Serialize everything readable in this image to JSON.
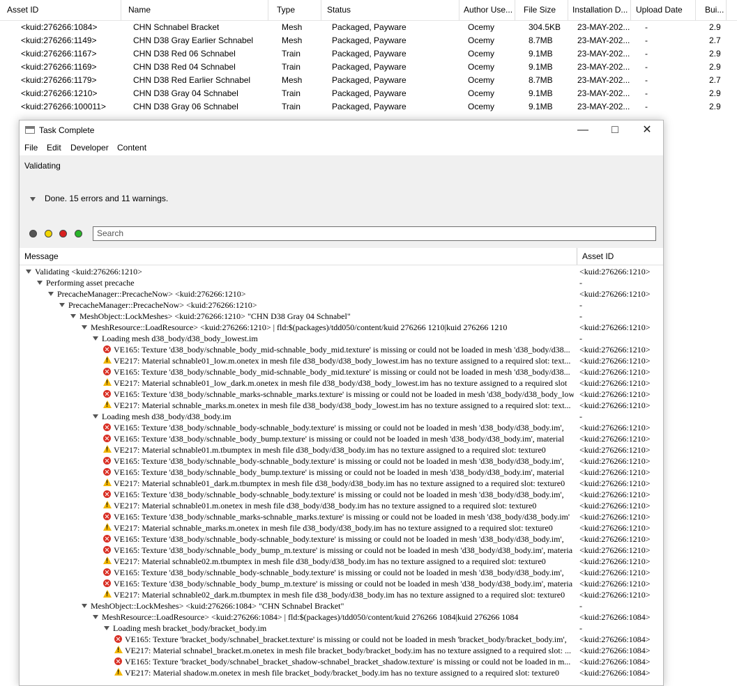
{
  "table": {
    "columns": [
      "Asset ID",
      "Name",
      "Type",
      "Status",
      "Author Use...",
      "File Size",
      "Installation D...",
      "Upload Date",
      "Bui..."
    ],
    "rows": [
      {
        "icon": "mesh-icon",
        "kuid": "<kuid:276266:1084>",
        "name": "CHN Schnabel Bracket",
        "type": "Mesh",
        "status": "Packaged, Payware",
        "author": "Ocemy",
        "size": "304.5KB",
        "installed": "23-MAY-202...",
        "upload": "-",
        "build": "2.9"
      },
      {
        "icon": "mesh-icon",
        "kuid": "<kuid:276266:1149>",
        "name": "CHN D38 Gray Earlier Schnabel",
        "type": "Mesh",
        "status": "Packaged, Payware",
        "author": "Ocemy",
        "size": "8.7MB",
        "installed": "23-MAY-202...",
        "upload": "-",
        "build": "2.7"
      },
      {
        "icon": "train-icon",
        "kuid": "<kuid:276266:1167>",
        "name": "CHN D38 Red 06 Schnabel",
        "type": "Train",
        "status": "Packaged, Payware",
        "author": "Ocemy",
        "size": "9.1MB",
        "installed": "23-MAY-202...",
        "upload": "-",
        "build": "2.9"
      },
      {
        "icon": "train-icon",
        "kuid": "<kuid:276266:1169>",
        "name": "CHN D38 Red 04 Schnabel",
        "type": "Train",
        "status": "Packaged, Payware",
        "author": "Ocemy",
        "size": "9.1MB",
        "installed": "23-MAY-202...",
        "upload": "-",
        "build": "2.9"
      },
      {
        "icon": "mesh-icon",
        "kuid": "<kuid:276266:1179>",
        "name": "CHN D38 Red Earlier Schnabel",
        "type": "Mesh",
        "status": "Packaged, Payware",
        "author": "Ocemy",
        "size": "8.7MB",
        "installed": "23-MAY-202...",
        "upload": "-",
        "build": "2.7"
      },
      {
        "icon": "train-icon",
        "kuid": "<kuid:276266:1210>",
        "name": "CHN D38 Gray 04 Schnabel",
        "type": "Train",
        "status": "Packaged, Payware",
        "author": "Ocemy",
        "size": "9.1MB",
        "installed": "23-MAY-202...",
        "upload": "-",
        "build": "2.9"
      },
      {
        "icon": "train-icon",
        "kuid": "<kuid:276266:100011>",
        "name": "CHN D38 Gray 06 Schnabel",
        "type": "Train",
        "status": "Packaged, Payware",
        "author": "Ocemy",
        "size": "9.1MB",
        "installed": "23-MAY-202...",
        "upload": "-",
        "build": "2.9"
      }
    ]
  },
  "dialog": {
    "title": "Task Complete",
    "menu": [
      "File",
      "Edit",
      "Developer",
      "Content"
    ],
    "phase": "Validating",
    "summary": "Done. 15 errors and 11 warnings.",
    "search_placeholder": "Search",
    "filter_colors": [
      "#555555",
      "#f2d600",
      "#d92020",
      "#28b428"
    ],
    "columns": {
      "message": "Message",
      "asset_id": "Asset ID"
    },
    "log": [
      {
        "level": 0,
        "kind": "expand",
        "text": "Validating <kuid:276266:1210>",
        "asset": "<kuid:276266:1210>"
      },
      {
        "level": 1,
        "kind": "expand",
        "text": "Performing asset precache",
        "asset": "-"
      },
      {
        "level": 2,
        "kind": "expand",
        "text": "PrecacheManager::PrecacheNow> <kuid:276266:1210>",
        "asset": "<kuid:276266:1210>"
      },
      {
        "level": 3,
        "kind": "expand",
        "text": "PrecacheManager::PrecacheNow> <kuid:276266:1210>",
        "asset": "-"
      },
      {
        "level": 4,
        "kind": "expand",
        "text": "MeshObject::LockMeshes> <kuid:276266:1210> \"CHN D38 Gray 04 Schnabel\"",
        "asset": "-"
      },
      {
        "level": 5,
        "kind": "expand",
        "text": "MeshResource::LoadResource> <kuid:276266:1210> | fld:$(packages)/tdd050/content/kuid 276266 1210|kuid 276266 1210",
        "asset": "<kuid:276266:1210>"
      },
      {
        "level": 6,
        "kind": "expand",
        "text": "Loading mesh d38_body/d38_body_lowest.im",
        "asset": "-"
      },
      {
        "level": 7,
        "kind": "error",
        "text": "VE165: Texture 'd38_body/schnable_body_mid-schnable_body_mid.texture' is missing or could not be loaded in mesh 'd38_body/d38...",
        "asset": "<kuid:276266:1210>"
      },
      {
        "level": 7,
        "kind": "warning",
        "text": "VE217: Material schnable01_low.m.onetex in mesh file d38_body/d38_body_lowest.im has no texture assigned to a required slot: text...",
        "asset": "<kuid:276266:1210>"
      },
      {
        "level": 7,
        "kind": "error",
        "text": "VE165: Texture 'd38_body/schnable_body_mid-schnable_body_mid.texture' is missing or could not be loaded in mesh 'd38_body/d38...",
        "asset": "<kuid:276266:1210>"
      },
      {
        "level": 7,
        "kind": "warning",
        "text": "VE217: Material schnable01_low_dark.m.onetex in mesh file d38_body/d38_body_lowest.im has no texture assigned to a required slot",
        "asset": "<kuid:276266:1210>"
      },
      {
        "level": 7,
        "kind": "error",
        "text": "VE165: Texture 'd38_body/schnable_marks-schnable_marks.texture' is missing or could not be loaded in mesh 'd38_body/d38_body_low",
        "asset": "<kuid:276266:1210>"
      },
      {
        "level": 7,
        "kind": "warning",
        "text": "VE217: Material schnable_marks.m.onetex in mesh file d38_body/d38_body_lowest.im has no texture assigned to a required slot: text...",
        "asset": "<kuid:276266:1210>"
      },
      {
        "level": 6,
        "kind": "expand",
        "text": "Loading mesh d38_body/d38_body.im",
        "asset": "-"
      },
      {
        "level": 7,
        "kind": "error",
        "text": "VE165: Texture 'd38_body/schnable_body-schnable_body.texture' is missing or could not be loaded in mesh 'd38_body/d38_body.im',",
        "asset": "<kuid:276266:1210>"
      },
      {
        "level": 7,
        "kind": "error",
        "text": "VE165: Texture 'd38_body/schnable_body_bump.texture' is missing or could not be loaded in mesh 'd38_body/d38_body.im', material",
        "asset": "<kuid:276266:1210>"
      },
      {
        "level": 7,
        "kind": "warning",
        "text": "VE217: Material schnable01.m.tbumptex in mesh file d38_body/d38_body.im has no texture assigned to a required slot: texture0",
        "asset": "<kuid:276266:1210>"
      },
      {
        "level": 7,
        "kind": "error",
        "text": "VE165: Texture 'd38_body/schnable_body-schnable_body.texture' is missing or could not be loaded in mesh 'd38_body/d38_body.im',",
        "asset": "<kuid:276266:1210>"
      },
      {
        "level": 7,
        "kind": "error",
        "text": "VE165: Texture 'd38_body/schnable_body_bump.texture' is missing or could not be loaded in mesh 'd38_body/d38_body.im', material",
        "asset": "<kuid:276266:1210>"
      },
      {
        "level": 7,
        "kind": "warning",
        "text": "VE217: Material schnable01_dark.m.tbumptex in mesh file d38_body/d38_body.im has no texture assigned to a required slot: texture0",
        "asset": "<kuid:276266:1210>"
      },
      {
        "level": 7,
        "kind": "error",
        "text": "VE165: Texture 'd38_body/schnable_body-schnable_body.texture' is missing or could not be loaded in mesh 'd38_body/d38_body.im',",
        "asset": "<kuid:276266:1210>"
      },
      {
        "level": 7,
        "kind": "warning",
        "text": "VE217: Material schnable01.m.onetex in mesh file d38_body/d38_body.im has no texture assigned to a required slot: texture0",
        "asset": "<kuid:276266:1210>"
      },
      {
        "level": 7,
        "kind": "error",
        "text": "VE165: Texture 'd38_body/schnable_marks-schnable_marks.texture' is missing or could not be loaded in mesh 'd38_body/d38_body.im'",
        "asset": "<kuid:276266:1210>"
      },
      {
        "level": 7,
        "kind": "warning",
        "text": "VE217: Material schnable_marks.m.onetex in mesh file d38_body/d38_body.im has no texture assigned to a required slot: texture0",
        "asset": "<kuid:276266:1210>"
      },
      {
        "level": 7,
        "kind": "error",
        "text": "VE165: Texture 'd38_body/schnable_body-schnable_body.texture' is missing or could not be loaded in mesh 'd38_body/d38_body.im',",
        "asset": "<kuid:276266:1210>"
      },
      {
        "level": 7,
        "kind": "error",
        "text": "VE165: Texture 'd38_body/schnable_body_bump_m.texture' is missing or could not be loaded in mesh 'd38_body/d38_body.im', materia",
        "asset": "<kuid:276266:1210>"
      },
      {
        "level": 7,
        "kind": "warning",
        "text": "VE217: Material schnable02.m.tbumptex in mesh file d38_body/d38_body.im has no texture assigned to a required slot: texture0",
        "asset": "<kuid:276266:1210>"
      },
      {
        "level": 7,
        "kind": "error",
        "text": "VE165: Texture 'd38_body/schnable_body-schnable_body.texture' is missing or could not be loaded in mesh 'd38_body/d38_body.im',",
        "asset": "<kuid:276266:1210>"
      },
      {
        "level": 7,
        "kind": "error",
        "text": "VE165: Texture 'd38_body/schnable_body_bump_m.texture' is missing or could not be loaded in mesh 'd38_body/d38_body.im', materia",
        "asset": "<kuid:276266:1210>"
      },
      {
        "level": 7,
        "kind": "warning",
        "text": "VE217: Material schnable02_dark.m.tbumptex in mesh file d38_body/d38_body.im has no texture assigned to a required slot: texture0",
        "asset": "<kuid:276266:1210>"
      },
      {
        "level": 5,
        "kind": "expand",
        "text": "MeshObject::LockMeshes> <kuid:276266:1084> \"CHN Schnabel Bracket\"",
        "asset": "-"
      },
      {
        "level": 6,
        "kind": "expand",
        "text": "MeshResource::LoadResource> <kuid:276266:1084> | fld:$(packages)/tdd050/content/kuid 276266 1084|kuid 276266 1084",
        "asset": "<kuid:276266:1084>"
      },
      {
        "level": 7,
        "kind": "expand",
        "text": "Loading mesh bracket_body/bracket_body.im",
        "asset": "-"
      },
      {
        "level": 8,
        "kind": "error",
        "text": "VE165: Texture 'bracket_body/schnabel_bracket.texture' is missing or could not be loaded in mesh 'bracket_body/bracket_body.im',",
        "asset": "<kuid:276266:1084>"
      },
      {
        "level": 8,
        "kind": "warning",
        "text": "VE217: Material schnabel_bracket.m.onetex in mesh file bracket_body/bracket_body.im has no texture assigned to a required slot: ...",
        "asset": "<kuid:276266:1084>"
      },
      {
        "level": 8,
        "kind": "error",
        "text": "VE165: Texture 'bracket_body/schnabel_bracket_shadow-schnabel_bracket_shadow.texture' is missing or could not be loaded in m...",
        "asset": "<kuid:276266:1084>"
      },
      {
        "level": 8,
        "kind": "warning",
        "text": "VE217: Material shadow.m.onetex in mesh file bracket_body/bracket_body.im has no texture assigned to a required slot: texture0",
        "asset": "<kuid:276266:1084>"
      }
    ]
  }
}
